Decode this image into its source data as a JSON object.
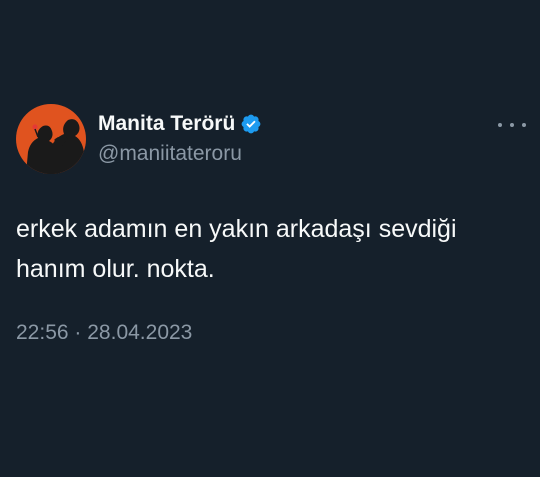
{
  "tweet": {
    "display_name": "Manita Terörü",
    "handle": "@maniitateroru",
    "verified": true,
    "text": "erkek adamın en yakın arkadaşı sevdiği\nhanım olur. nokta.",
    "time": "22:56",
    "separator": "·",
    "date": "28.04.2023"
  },
  "icons": {
    "verified": "verified-badge-icon",
    "more": "more-options-icon"
  },
  "colors": {
    "background": "#15202b",
    "text_primary": "#f7f9f9",
    "text_secondary": "#8b98a5",
    "verified_badge": "#1d9bf0",
    "avatar_background": "#e0531f"
  }
}
